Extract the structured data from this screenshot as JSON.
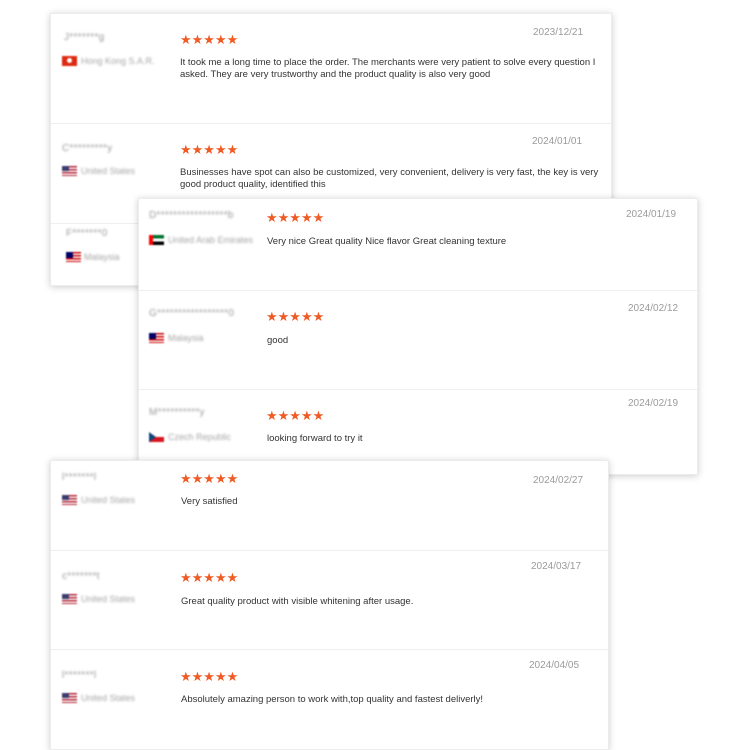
{
  "card1": {
    "reviews": [
      {
        "name": "J*******g",
        "country": "Hong Kong S.A.R.",
        "flag": "hong-kong-flag",
        "stars": "★★★★★",
        "rating": 5,
        "date": "2023/12/21",
        "text": "It took me a long time to place the order. The merchants were very patient to solve every question I asked. They are very trustworthy and the product quality is also very good"
      },
      {
        "name": "C*********y",
        "country": "United States",
        "flag": "us-flag",
        "stars": "★★★★★",
        "rating": 5,
        "date": "2024/01/01",
        "text": "Businesses have spot can also be customized, very convenient, delivery is very fast, the key is very good product quality, identified this"
      },
      {
        "name": "F*******0",
        "country": "Malaysia",
        "flag": "malaysia-flag"
      }
    ]
  },
  "card2": {
    "reviews": [
      {
        "name": "D*****************b",
        "country": "United Arab Emirates",
        "flag": "uae-flag",
        "stars": "★★★★★",
        "rating": 5,
        "date": "2024/01/19",
        "text": "Very nice Great quality Nice flavor Great cleaning texture"
      },
      {
        "name": "G*****************0",
        "country": "Malaysia",
        "flag": "malaysia-flag",
        "stars": "★★★★★",
        "rating": 5,
        "date": "2024/02/12",
        "text": "good"
      },
      {
        "name": "M**********y",
        "country": "Czech Republic",
        "flag": "czech-flag",
        "stars": "★★★★★",
        "rating": 5,
        "date": "2024/02/19",
        "text": "looking forward to try it"
      }
    ]
  },
  "card3": {
    "reviews": [
      {
        "name": "l*******l",
        "country": "United States",
        "flag": "us-flag",
        "stars": "★★★★★",
        "rating": 5,
        "date": "2024/02/27",
        "text": "Very satisfied"
      },
      {
        "name": "c*******t",
        "country": "United States",
        "flag": "us-flag",
        "stars": "★★★★★",
        "rating": 5,
        "date": "2024/03/17",
        "text": "Great quality product with visible whitening after usage."
      },
      {
        "name": "l*******l",
        "country": "United States",
        "flag": "us-flag",
        "stars": "★★★★★",
        "rating": 5,
        "date": "2024/04/05",
        "text": "Absolutely amazing person to work with,top quality and fastest deliverly!"
      }
    ]
  },
  "colors": {
    "star": "#f05a24",
    "date": "#9b9b9b",
    "text": "#333333"
  }
}
